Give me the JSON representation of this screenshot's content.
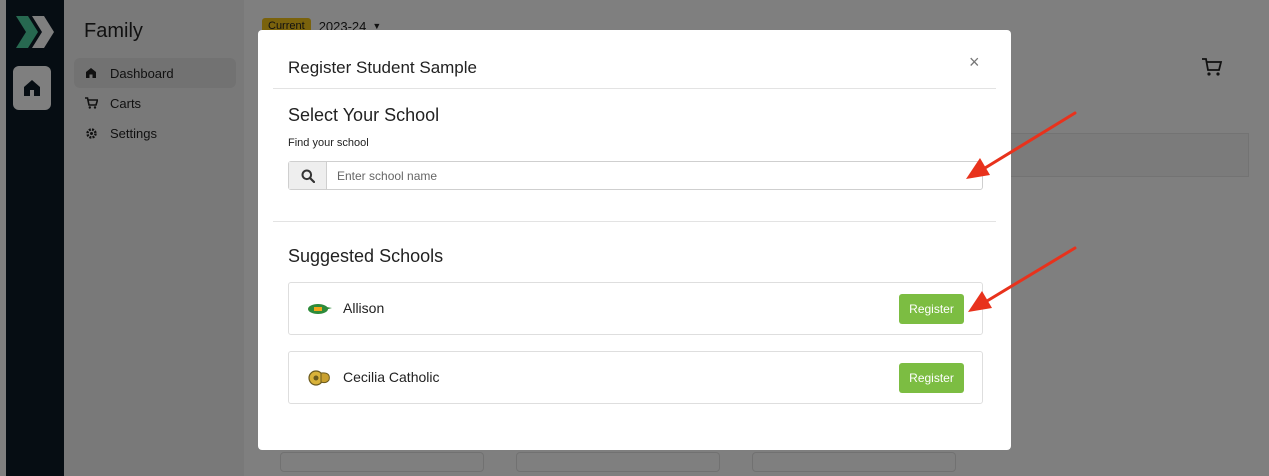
{
  "sidebar": {
    "title": "Family",
    "items": [
      {
        "label": "Dashboard",
        "icon": "home-icon",
        "active": true
      },
      {
        "label": "Carts",
        "icon": "cart-icon",
        "active": false
      },
      {
        "label": "Settings",
        "icon": "gear-icon",
        "active": false
      }
    ]
  },
  "header": {
    "season_badge": "Current",
    "season_value": "2023-24"
  },
  "modal": {
    "title": "Register Student Sample",
    "close_label": "×",
    "select_section_title": "Select Your School",
    "find_label": "Find your school",
    "search_placeholder": "Enter school name",
    "search_value": "",
    "suggested_title": "Suggested Schools",
    "schools": [
      {
        "name": "Allison",
        "logo": "gator-logo",
        "button_label": "Register"
      },
      {
        "name": "Cecilia Catholic",
        "logo": "ram-logo",
        "button_label": "Register"
      }
    ]
  },
  "colors": {
    "accent_green": "#7cbd42",
    "annotation_red": "#e8321c",
    "season_badge_yellow": "#f5c518",
    "rail_dark": "#0d1a26"
  }
}
